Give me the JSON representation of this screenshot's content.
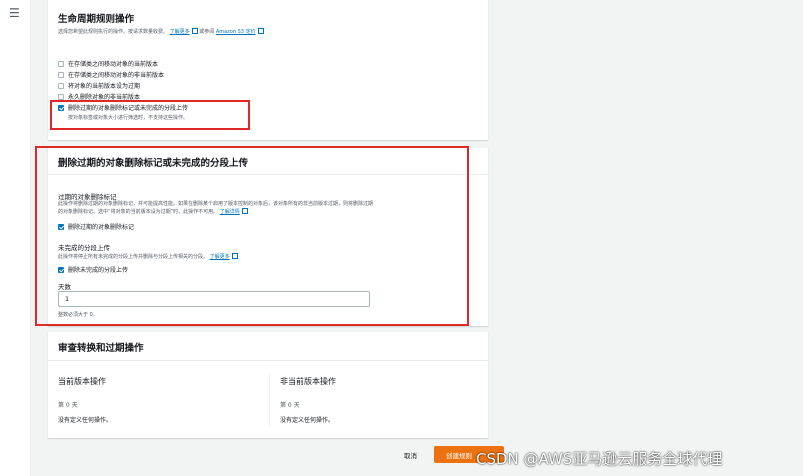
{
  "lifecycle": {
    "title": "生命周期规则操作",
    "desc_prefix": "选择您希望此规则执行的操作。按请求数量收费。",
    "learn_more": "了解更多",
    "or_see": "或参阅",
    "pricing_link": "Amazon S3 定价",
    "options": [
      {
        "label": "在存储类之间移动对象的当前版本",
        "checked": false
      },
      {
        "label": "在存储类之间移动对象的非当前版本",
        "checked": false
      },
      {
        "label": "将对象的当前版本设为过期",
        "checked": false
      },
      {
        "label": "永久删除对象的非当前版本",
        "checked": false
      },
      {
        "label": "删除过期的对象删除标记或未完成的分段上传",
        "checked": true
      }
    ],
    "note": "按对象标签或对象大小进行筛选时，不支持这些操作。"
  },
  "delete_section": {
    "title": "删除过期的对象删除标记或未完成的分段上传",
    "markers_heading": "过期的对象删除标记",
    "markers_desc_line1": "此操作将删除过期的对象删除标记，并可能提高性能。如果在删除某个启用了版本控制的对象后，该对象所有的非当前版本过期，则将删除过期",
    "markers_desc_line2": "的对象删除标记。选中“将对象的当前版本设为过期”时，此操作不可用。",
    "markers_learn_more": "了解详情",
    "markers_checkbox": "删除过期的对象删除标记",
    "multipart_heading": "未完成的分段上传",
    "multipart_desc": "此操作将停止所有未完成的分段上传并删除与分段上传相关的分段。",
    "multipart_learn_more": "了解更多",
    "multipart_checkbox": "删除未完成的分段上传",
    "days_label": "天数",
    "days_value": "1",
    "days_hint": "整数必须大于 0。"
  },
  "review": {
    "title": "审查转换和过期操作",
    "current_title": "当前版本操作",
    "current_day": "第 0 天",
    "current_empty": "没有定义任何操作。",
    "noncurrent_title": "非当前版本操作",
    "noncurrent_day": "第 0 天",
    "noncurrent_empty": "没有定义任何操作。"
  },
  "footer": {
    "cancel": "取消",
    "create": "创建规则"
  },
  "watermark": "CSDN @AWS亚马逊云服务全球代理"
}
